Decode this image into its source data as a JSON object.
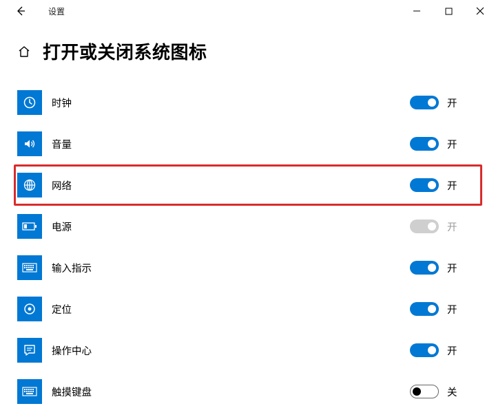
{
  "app": {
    "title": "设置"
  },
  "page": {
    "title": "打开或关闭系统图标"
  },
  "state_labels": {
    "on": "开",
    "off": "关"
  },
  "items": [
    {
      "key": "clock",
      "label": "时钟",
      "on": true,
      "disabled": false,
      "highlight": false
    },
    {
      "key": "volume",
      "label": "音量",
      "on": true,
      "disabled": false,
      "highlight": false
    },
    {
      "key": "network",
      "label": "网络",
      "on": true,
      "disabled": false,
      "highlight": true
    },
    {
      "key": "power",
      "label": "电源",
      "on": true,
      "disabled": true,
      "highlight": false
    },
    {
      "key": "input",
      "label": "输入指示",
      "on": true,
      "disabled": false,
      "highlight": false
    },
    {
      "key": "location",
      "label": "定位",
      "on": true,
      "disabled": false,
      "highlight": false
    },
    {
      "key": "actioncenter",
      "label": "操作中心",
      "on": true,
      "disabled": false,
      "highlight": false
    },
    {
      "key": "touchkeyboard",
      "label": "触摸键盘",
      "on": false,
      "disabled": false,
      "highlight": false
    }
  ]
}
